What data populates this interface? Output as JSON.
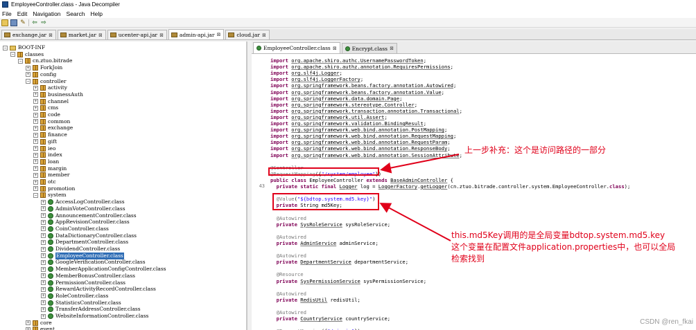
{
  "window": {
    "title": "EmployeeController.class - Java Decompiler"
  },
  "menu": [
    "File",
    "Edit",
    "Navigation",
    "Search",
    "Help"
  ],
  "toolbar": {
    "open_icon": "folder-open-icon",
    "save_icon": "save-icon",
    "search_icon": "wand-icon",
    "back_icon": "back-arrow-icon",
    "forward_icon": "forward-arrow-icon"
  },
  "jar_tabs": [
    {
      "label": "exchange.jar",
      "active": false
    },
    {
      "label": "market.jar",
      "active": false
    },
    {
      "label": "ucenter-api.jar",
      "active": false
    },
    {
      "label": "admin-api.jar",
      "active": true
    },
    {
      "label": "cloud.jar",
      "active": false
    }
  ],
  "tree": [
    {
      "label": "BOOT-INF",
      "level": 0,
      "toggle": "−",
      "icon": "folder"
    },
    {
      "label": "classes",
      "level": 1,
      "toggle": "−",
      "icon": "package"
    },
    {
      "label": "cn.ztuo.bitrade",
      "level": 2,
      "toggle": "−",
      "icon": "package"
    },
    {
      "label": "ForkJoin",
      "level": 3,
      "toggle": "+",
      "icon": "package"
    },
    {
      "label": "config",
      "level": 3,
      "toggle": "+",
      "icon": "package"
    },
    {
      "label": "controller",
      "level": 3,
      "toggle": "−",
      "icon": "package"
    },
    {
      "label": "activity",
      "level": 4,
      "toggle": "+",
      "icon": "package"
    },
    {
      "label": "businessAuth",
      "level": 4,
      "toggle": "+",
      "icon": "package"
    },
    {
      "label": "channel",
      "level": 4,
      "toggle": "+",
      "icon": "package"
    },
    {
      "label": "cms",
      "level": 4,
      "toggle": "+",
      "icon": "package"
    },
    {
      "label": "code",
      "level": 4,
      "toggle": "+",
      "icon": "package"
    },
    {
      "label": "common",
      "level": 4,
      "toggle": "+",
      "icon": "package"
    },
    {
      "label": "exchange",
      "level": 4,
      "toggle": "+",
      "icon": "package"
    },
    {
      "label": "finance",
      "level": 4,
      "toggle": "+",
      "icon": "package"
    },
    {
      "label": "gift",
      "level": 4,
      "toggle": "+",
      "icon": "package"
    },
    {
      "label": "ieo",
      "level": 4,
      "toggle": "+",
      "icon": "package"
    },
    {
      "label": "index",
      "level": 4,
      "toggle": "+",
      "icon": "package"
    },
    {
      "label": "loan",
      "level": 4,
      "toggle": "+",
      "icon": "package"
    },
    {
      "label": "margin",
      "level": 4,
      "toggle": "+",
      "icon": "package"
    },
    {
      "label": "member",
      "level": 4,
      "toggle": "+",
      "icon": "package"
    },
    {
      "label": "otc",
      "level": 4,
      "toggle": "+",
      "icon": "package"
    },
    {
      "label": "promotion",
      "level": 4,
      "toggle": "+",
      "icon": "package"
    },
    {
      "label": "system",
      "level": 4,
      "toggle": "−",
      "icon": "package"
    },
    {
      "label": "AccessLogController.class",
      "level": 5,
      "toggle": "+",
      "icon": "class"
    },
    {
      "label": "AdminVoteController.class",
      "level": 5,
      "toggle": "+",
      "icon": "class"
    },
    {
      "label": "AnnouncementController.class",
      "level": 5,
      "toggle": "+",
      "icon": "class"
    },
    {
      "label": "AppRevisionController.class",
      "level": 5,
      "toggle": "+",
      "icon": "class"
    },
    {
      "label": "CoinController.class",
      "level": 5,
      "toggle": "+",
      "icon": "class"
    },
    {
      "label": "DataDictionaryController.class",
      "level": 5,
      "toggle": "+",
      "icon": "class"
    },
    {
      "label": "DepartmentController.class",
      "level": 5,
      "toggle": "+",
      "icon": "class"
    },
    {
      "label": "DividendController.class",
      "level": 5,
      "toggle": "+",
      "icon": "class"
    },
    {
      "label": "EmployeeController.class",
      "level": 5,
      "toggle": "+",
      "icon": "class",
      "selected": true
    },
    {
      "label": "GoogleVerificationController.class",
      "level": 5,
      "toggle": "+",
      "icon": "class"
    },
    {
      "label": "MemberApplicationConfigController.class",
      "level": 5,
      "toggle": "+",
      "icon": "class"
    },
    {
      "label": "MemberBonusController.class",
      "level": 5,
      "toggle": "+",
      "icon": "class"
    },
    {
      "label": "PermissionController.class",
      "level": 5,
      "toggle": "+",
      "icon": "class"
    },
    {
      "label": "RewardActivityRecordController.class",
      "level": 5,
      "toggle": "+",
      "icon": "class"
    },
    {
      "label": "RoleController.class",
      "level": 5,
      "toggle": "+",
      "icon": "class"
    },
    {
      "label": "StatisticsController.class",
      "level": 5,
      "toggle": "+",
      "icon": "class"
    },
    {
      "label": "TransferAddressController.class",
      "level": 5,
      "toggle": "+",
      "icon": "class"
    },
    {
      "label": "WebsiteInformationController.class",
      "level": 5,
      "toggle": "+",
      "icon": "class"
    },
    {
      "label": "core",
      "level": 3,
      "toggle": "+",
      "icon": "package"
    },
    {
      "label": "event",
      "level": 3,
      "toggle": "+",
      "icon": "package"
    }
  ],
  "file_tabs": [
    {
      "label": "EmployeeController.class",
      "active": true
    },
    {
      "label": "Encrypt.class",
      "active": false
    }
  ],
  "code_lines": [
    {
      "n": "",
      "parts": [
        [
          "kw",
          "import "
        ],
        [
          "pk",
          "org.apache.shiro.authc.UsernamePasswordToken"
        ],
        [
          "",
          "; "
        ]
      ]
    },
    {
      "n": "",
      "parts": [
        [
          "kw",
          "import "
        ],
        [
          "pk",
          "org.apache.shiro.authz.annotation.RequiresPermissions"
        ],
        [
          "",
          ";"
        ]
      ]
    },
    {
      "n": "",
      "parts": [
        [
          "kw",
          "import "
        ],
        [
          "pk",
          "org.slf4j.Logger"
        ],
        [
          "",
          ";"
        ]
      ]
    },
    {
      "n": "",
      "parts": [
        [
          "kw",
          "import "
        ],
        [
          "pk",
          "org.slf4j.LoggerFactory"
        ],
        [
          "",
          ";"
        ]
      ]
    },
    {
      "n": "",
      "parts": [
        [
          "kw",
          "import "
        ],
        [
          "pk",
          "org.springframework.beans.factory.annotation.Autowired"
        ],
        [
          "",
          ";"
        ]
      ]
    },
    {
      "n": "",
      "parts": [
        [
          "kw",
          "import "
        ],
        [
          "pk",
          "org.springframework.beans.factory.annotation.Value"
        ],
        [
          "",
          ";"
        ]
      ]
    },
    {
      "n": "",
      "parts": [
        [
          "kw",
          "import "
        ],
        [
          "pk",
          "org.springframework.data.domain.Page"
        ],
        [
          "",
          ";"
        ]
      ]
    },
    {
      "n": "",
      "parts": [
        [
          "kw",
          "import "
        ],
        [
          "pk",
          "org.springframework.stereotype.Controller"
        ],
        [
          "",
          ";"
        ]
      ]
    },
    {
      "n": "",
      "parts": [
        [
          "kw",
          "import "
        ],
        [
          "pk",
          "org.springframework.transaction.annotation.Transactional"
        ],
        [
          "",
          ";"
        ]
      ]
    },
    {
      "n": "",
      "parts": [
        [
          "kw",
          "import "
        ],
        [
          "pk",
          "org.springframework.util.Assert"
        ],
        [
          "",
          ";"
        ]
      ]
    },
    {
      "n": "",
      "parts": [
        [
          "kw",
          "import "
        ],
        [
          "pk",
          "org.springframework.validation.BindingResult"
        ],
        [
          "",
          ";"
        ]
      ]
    },
    {
      "n": "",
      "parts": [
        [
          "kw",
          "import "
        ],
        [
          "pk",
          "org.springframework.web.bind.annotation.PostMapping"
        ],
        [
          "",
          ";"
        ]
      ]
    },
    {
      "n": "",
      "parts": [
        [
          "kw",
          "import "
        ],
        [
          "pk",
          "org.springframework.web.bind.annotation.RequestMapping"
        ],
        [
          "",
          ";"
        ]
      ]
    },
    {
      "n": "",
      "parts": [
        [
          "kw",
          "import "
        ],
        [
          "pk",
          "org.springframework.web.bind.annotation.RequestParam"
        ],
        [
          "",
          ";"
        ]
      ]
    },
    {
      "n": "",
      "parts": [
        [
          "kw",
          "import "
        ],
        [
          "pk",
          "org.springframework.web.bind.annotation.ResponseBody"
        ],
        [
          "",
          ";"
        ]
      ]
    },
    {
      "n": "",
      "parts": [
        [
          "kw",
          "import "
        ],
        [
          "pk",
          "org.springframework.web.bind.annotation.SessionAttribute"
        ],
        [
          "",
          ";"
        ]
      ]
    },
    {
      "n": "",
      "parts": []
    },
    {
      "n": "",
      "parts": [
        [
          "an",
          "@Controller"
        ]
      ]
    },
    {
      "n": "",
      "parts": [
        [
          "an",
          "@RequestMapping"
        ],
        [
          "",
          "({"
        ],
        [
          "str",
          "\"/system/employee\""
        ],
        [
          "",
          "})"
        ]
      ]
    },
    {
      "n": "",
      "parts": [
        [
          "kw",
          "public class "
        ],
        [
          "",
          "EmployeeController "
        ],
        [
          "kw",
          "extends "
        ],
        [
          "ty",
          "BaseAdminController"
        ],
        [
          "",
          " {"
        ]
      ]
    },
    {
      "n": "43",
      "parts": [
        [
          "",
          "  "
        ],
        [
          "kw",
          "private static final "
        ],
        [
          "ty",
          "Logger"
        ],
        [
          "",
          " log = "
        ],
        [
          "ty",
          "LoggerFactory"
        ],
        [
          "",
          "."
        ],
        [
          "ty",
          "getLogger"
        ],
        [
          "",
          "(cn.ztuo.bitrade.controller.system.EmployeeController."
        ],
        [
          "kw",
          "class"
        ],
        [
          "",
          ");"
        ]
      ]
    },
    {
      "n": "",
      "parts": []
    },
    {
      "n": "",
      "parts": [
        [
          "",
          "  "
        ],
        [
          "an",
          "@Value"
        ],
        [
          "",
          "("
        ],
        [
          "str",
          "\"${bdtop.system.md5.key}\""
        ],
        [
          "",
          ")"
        ]
      ]
    },
    {
      "n": "",
      "parts": [
        [
          "",
          "  "
        ],
        [
          "kw",
          "private "
        ],
        [
          "",
          "String md5Key;"
        ]
      ]
    },
    {
      "n": "",
      "parts": []
    },
    {
      "n": "",
      "parts": [
        [
          "",
          "  "
        ],
        [
          "an",
          "@Autowired"
        ]
      ]
    },
    {
      "n": "",
      "parts": [
        [
          "",
          "  "
        ],
        [
          "kw",
          "private "
        ],
        [
          "ty",
          "SysRoleService"
        ],
        [
          "",
          " sysRoleService;"
        ]
      ]
    },
    {
      "n": "",
      "parts": []
    },
    {
      "n": "",
      "parts": [
        [
          "",
          "  "
        ],
        [
          "an",
          "@Autowired"
        ]
      ]
    },
    {
      "n": "",
      "parts": [
        [
          "",
          "  "
        ],
        [
          "kw",
          "private "
        ],
        [
          "ty",
          "AdminService"
        ],
        [
          "",
          " adminService;"
        ]
      ]
    },
    {
      "n": "",
      "parts": []
    },
    {
      "n": "",
      "parts": [
        [
          "",
          "  "
        ],
        [
          "an",
          "@Autowired"
        ]
      ]
    },
    {
      "n": "",
      "parts": [
        [
          "",
          "  "
        ],
        [
          "kw",
          "private "
        ],
        [
          "ty",
          "DepartmentService"
        ],
        [
          "",
          " departmentService;"
        ]
      ]
    },
    {
      "n": "",
      "parts": []
    },
    {
      "n": "",
      "parts": [
        [
          "",
          "  "
        ],
        [
          "an",
          "@Resource"
        ]
      ]
    },
    {
      "n": "",
      "parts": [
        [
          "",
          "  "
        ],
        [
          "kw",
          "private "
        ],
        [
          "ty",
          "SysPermissionService"
        ],
        [
          "",
          " sysPermissionService;"
        ]
      ]
    },
    {
      "n": "",
      "parts": []
    },
    {
      "n": "",
      "parts": [
        [
          "",
          "  "
        ],
        [
          "an",
          "@Autowired"
        ]
      ]
    },
    {
      "n": "",
      "parts": [
        [
          "",
          "  "
        ],
        [
          "kw",
          "private "
        ],
        [
          "ty",
          "RedisUtil"
        ],
        [
          "",
          " redisUtil;"
        ]
      ]
    },
    {
      "n": "",
      "parts": []
    },
    {
      "n": "",
      "parts": [
        [
          "",
          "  "
        ],
        [
          "an",
          "@Autowired"
        ]
      ]
    },
    {
      "n": "",
      "parts": [
        [
          "",
          "  "
        ],
        [
          "kw",
          "private "
        ],
        [
          "ty",
          "CountryService"
        ],
        [
          "",
          " countryService;"
        ]
      ]
    },
    {
      "n": "",
      "parts": []
    },
    {
      "n": "",
      "parts": [
        [
          "",
          "  "
        ],
        [
          "an",
          "@RequestMapping"
        ],
        [
          "",
          "({"
        ],
        [
          "str",
          "\"/signin\""
        ],
        [
          "",
          "})"
        ]
      ]
    }
  ],
  "annotations": {
    "note1": "上一步补充：这个是访问路径的一部分",
    "note2_line1": "this.md5Key调用的是全局变量bdtop.system.md5.key",
    "note2_line2": "这个变量在配置文件application.properties中，也可以全局",
    "note2_line3": "检索找到",
    "color": "#e0001a"
  },
  "watermark": "CSDN @ren_fkai"
}
